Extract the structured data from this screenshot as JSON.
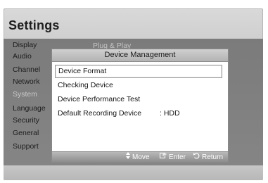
{
  "title": "Settings",
  "sidebar": {
    "items": [
      {
        "label": "Display",
        "dim": false
      },
      {
        "label": "Audio",
        "dim": false
      },
      {
        "label": "Channel",
        "dim": false
      },
      {
        "label": "Network",
        "dim": false
      },
      {
        "label": "System",
        "dim": true
      },
      {
        "label": "Language",
        "dim": false
      },
      {
        "label": "Security",
        "dim": false
      },
      {
        "label": "General",
        "dim": false
      },
      {
        "label": "Support",
        "dim": false
      }
    ]
  },
  "behind_menu": {
    "label": "Plug & Play"
  },
  "dialog": {
    "title": "Device Management",
    "items": [
      {
        "label": "Device Format",
        "value": "",
        "selected": true
      },
      {
        "label": "Checking Device",
        "value": "",
        "selected": false
      },
      {
        "label": "Device Performance Test",
        "value": "",
        "selected": false
      },
      {
        "label": "Default Recording Device",
        "value": ": HDD",
        "selected": false
      }
    ],
    "footer": {
      "move_label": "Move",
      "enter_label": "Enter",
      "return_label": "Return"
    }
  },
  "colors": {
    "panel": "#7f7f7f",
    "dialog_header": "#c2c2c2",
    "dim_text": "#c9c9c9"
  },
  "icons": {
    "move": "up-down-arrows-icon",
    "enter": "enter-icon",
    "return": "return-icon"
  }
}
